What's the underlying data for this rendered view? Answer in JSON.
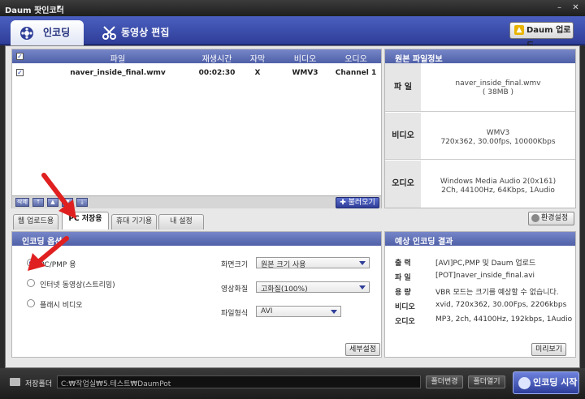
{
  "window": {
    "title": "Daum 팟인코더"
  },
  "main_tabs": [
    {
      "label": "인코딩",
      "icon": "film-reel-icon"
    },
    {
      "label": "동영상 편집",
      "icon": "scissors-icon"
    }
  ],
  "header": {
    "daum_upload_label": "Daum 업로드"
  },
  "file_list": {
    "columns": [
      "파일",
      "재생시간",
      "자막",
      "비디오",
      "오디오"
    ],
    "rows": [
      {
        "checked": true,
        "file": "naver_inside_final.wmv",
        "duration": "00:02:30",
        "subtitle": "X",
        "video": "WMV3",
        "audio": "Channel 1"
      }
    ],
    "toolbar_delete": "삭제",
    "load_label": "불러오기"
  },
  "original_info": {
    "title": "원본 파일정보",
    "rows": [
      {
        "key": "파 일",
        "lines": [
          "naver_inside_final.wmv",
          "( 38MB )"
        ]
      },
      {
        "key": "비디오",
        "lines": [
          "WMV3",
          "720x362, 30.00fps, 10000Kbps"
        ]
      },
      {
        "key": "오디오",
        "lines": [
          "Windows Media Audio 2(0x161)",
          "2Ch, 44100Hz, 64Kbps, 1Audio"
        ]
      }
    ]
  },
  "settings_tabs": [
    "웹 업로드용",
    "PC 저장용",
    "휴대 기기용",
    "내 설정"
  ],
  "active_settings_tab": "PC 저장용",
  "env_settings_label": "환경설정",
  "encoding_options": {
    "title": "인코딩 옵션",
    "radios": [
      {
        "label": "PC/PMP 용",
        "selected": true
      },
      {
        "label": "인터넷 동영상(스트리밍)",
        "selected": false
      },
      {
        "label": "플래시 비디오",
        "selected": false
      }
    ],
    "fields": [
      {
        "label": "화면크기",
        "value": "원본 크기 사용"
      },
      {
        "label": "영상화질",
        "value": "고화질(100%)"
      },
      {
        "label": "파일형식",
        "value": "AVI"
      }
    ],
    "detail_button": "세부설정"
  },
  "expected_result": {
    "title": "예상 인코딩 결과",
    "rows": [
      {
        "key": "출 력",
        "value": "[AVI]PC,PMP 및 Daum 업로드"
      },
      {
        "key": "파 일",
        "value": "[POT]naver_inside_final.avi"
      },
      {
        "key": "용 량",
        "value": "VBR 모드는 크기를 예상할 수 없습니다."
      },
      {
        "key": "비디오",
        "value": "xvid, 720x362, 30.00Fps, 2206kbps"
      },
      {
        "key": "오디오",
        "value": "MP3, 2ch, 44100Hz, 192kbps, 1Audio"
      }
    ],
    "preview_button": "미리보기"
  },
  "bottom": {
    "save_folder_label": "저장폴더",
    "path": "C:₩작업실₩5.테스트₩DaumPot",
    "change_folder": "폴더변경",
    "open_folder": "폴더열기",
    "start_label": "인코딩 시작"
  },
  "colors": {
    "accent": "#2f3e98",
    "annotation": "#e02020"
  }
}
